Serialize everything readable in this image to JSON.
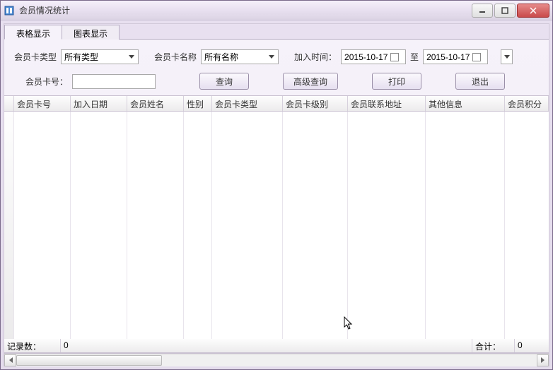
{
  "window": {
    "title": "会员情况统计"
  },
  "tabs": [
    "表格显示",
    "图表显示"
  ],
  "filters": {
    "cardTypeLabel": "会员卡类型",
    "cardTypeValue": "所有类型",
    "cardNameLabel": "会员卡名称",
    "cardNameValue": "所有名称",
    "joinTimeLabel": "加入时间：",
    "dateFrom": "2015-10-17",
    "toLabel": "至",
    "dateTo": "2015-10-17",
    "cardNoLabel": "会员卡号：",
    "cardNoValue": ""
  },
  "buttons": {
    "query": "查询",
    "advanced": "高级查询",
    "print": "打印",
    "exit": "退出"
  },
  "grid": {
    "columns": [
      "会员卡号",
      "加入日期",
      "会员姓名",
      "性别",
      "会员卡类型",
      "会员卡级别",
      "会员联系地址",
      "其他信息",
      "会员积分"
    ],
    "widths": [
      80,
      80,
      80,
      40,
      100,
      92,
      110,
      112,
      48
    ],
    "rows": []
  },
  "footer": {
    "recordLabel": "记录数：",
    "recordValue": "0",
    "sumLabel": "合计：",
    "sumValue": "0"
  }
}
